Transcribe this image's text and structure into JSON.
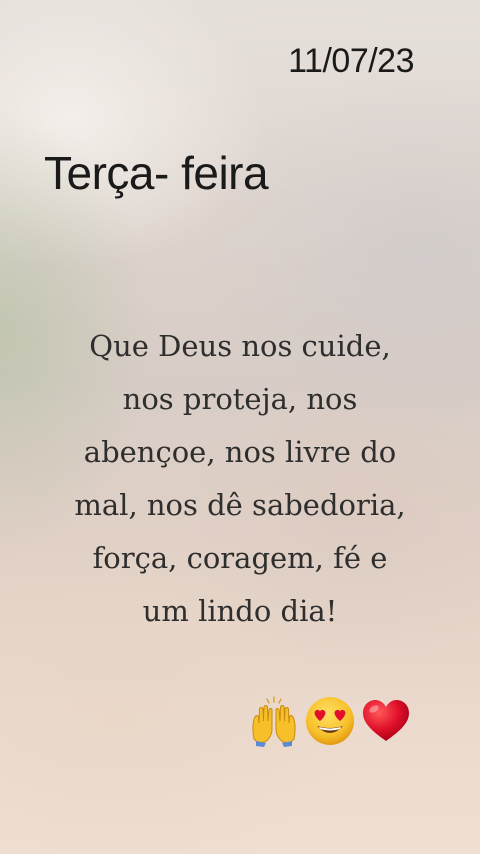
{
  "date": "11/07/23",
  "weekday": "Terça- feira",
  "message": {
    "lines": [
      "Que Deus nos cuide,",
      "nos proteja, nos",
      "abençoe, nos livre do",
      "mal, nos dê sabedoria,",
      "força, coragem, fé e",
      "um lindo dia!"
    ]
  },
  "emojis": [
    "raising-hands-icon",
    "heart-eyes-face-icon",
    "red-heart-icon"
  ],
  "colors": {
    "text": "#1a1a1a",
    "message_text": "#2e2e2e",
    "heart": "#e0102a",
    "emoji_yellow": "#f7c02a"
  }
}
